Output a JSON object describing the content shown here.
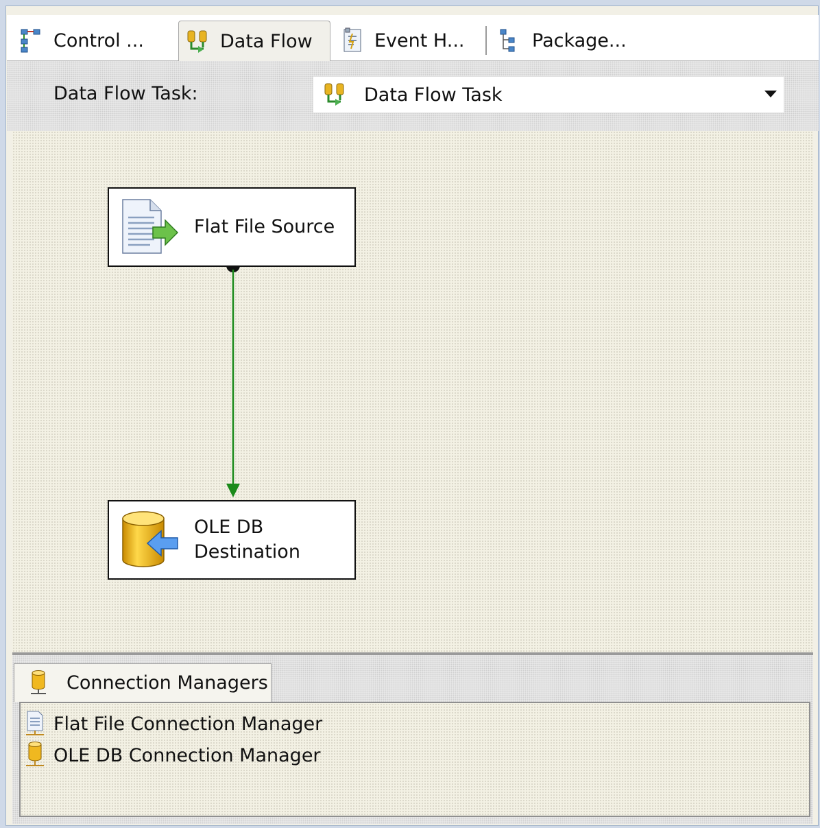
{
  "tabs": [
    {
      "label": "Control ...",
      "icon": "control-flow-icon"
    },
    {
      "label": "Data Flow",
      "icon": "data-flow-icon",
      "active": true
    },
    {
      "label": "Event H...",
      "icon": "event-handlers-icon"
    },
    {
      "label": "Package...",
      "icon": "package-explorer-icon"
    }
  ],
  "task_row": {
    "label": "Data Flow Task:",
    "selected": "Data Flow Task"
  },
  "components": {
    "source": {
      "label": "Flat File Source",
      "icon": "flat-file-source-icon"
    },
    "destination": {
      "label_line1": "OLE DB",
      "label_line2": "Destination",
      "icon": "ole-db-destination-icon"
    }
  },
  "connection_managers": {
    "tab_label": "Connection Managers",
    "items": [
      {
        "label": "Flat File Connection Manager",
        "icon": "flat-file-connection-icon"
      },
      {
        "label": "OLE DB Connection Manager",
        "icon": "ole-db-connection-icon"
      }
    ]
  },
  "colors": {
    "path_arrow": "#1a8a1a",
    "window_border": "#9fb2c9"
  }
}
